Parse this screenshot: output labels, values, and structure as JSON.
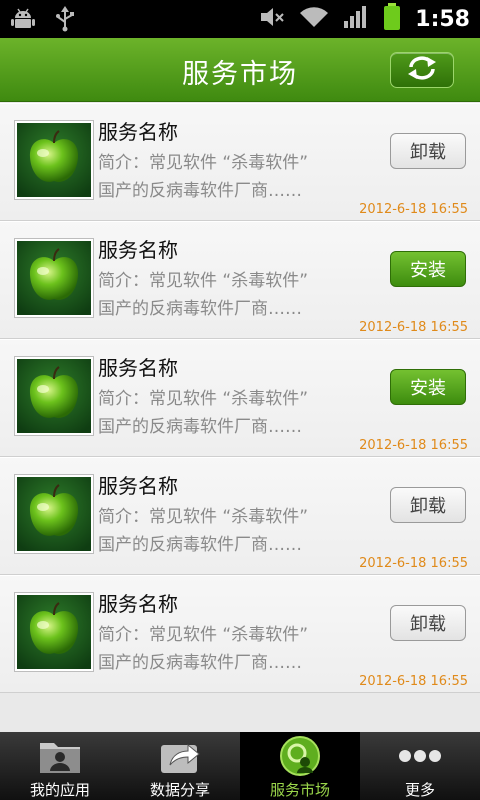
{
  "status_bar": {
    "time": "1:58",
    "icons": [
      "android-icon",
      "usb-icon",
      "mute-icon",
      "wifi-icon",
      "signal-icon",
      "battery-icon"
    ]
  },
  "header": {
    "title": "服务市场",
    "refresh_icon": "refresh-icon"
  },
  "colors": {
    "accent_green": "#4f9a1a",
    "date_orange": "#e08a1a",
    "active_tab_label": "#9ad64b"
  },
  "services": [
    {
      "name": "服务名称",
      "desc_line1": "简介：常见软件 “杀毒软件”",
      "desc_line2": "国产的反病毒软件厂商……",
      "date": "2012-6-18  16:55",
      "action": "卸载",
      "action_type": "uninstall"
    },
    {
      "name": "服务名称",
      "desc_line1": "简介：常见软件 “杀毒软件”",
      "desc_line2": "国产的反病毒软件厂商……",
      "date": "2012-6-18  16:55",
      "action": "安装",
      "action_type": "install"
    },
    {
      "name": "服务名称",
      "desc_line1": "简介：常见软件 “杀毒软件”",
      "desc_line2": "国产的反病毒软件厂商……",
      "date": "2012-6-18  16:55",
      "action": "安装",
      "action_type": "install"
    },
    {
      "name": "服务名称",
      "desc_line1": "简介：常见软件 “杀毒软件”",
      "desc_line2": "国产的反病毒软件厂商……",
      "date": "2012-6-18  16:55",
      "action": "卸载",
      "action_type": "uninstall"
    },
    {
      "name": "服务名称",
      "desc_line1": "简介：常见软件 “杀毒软件”",
      "desc_line2": "国产的反病毒软件厂商……",
      "date": "2012-6-18  16:55",
      "action": "卸载",
      "action_type": "uninstall"
    }
  ],
  "tabs": [
    {
      "label": "我的应用",
      "icon": "my-apps-icon",
      "active": false
    },
    {
      "label": "数据分享",
      "icon": "share-icon",
      "active": false
    },
    {
      "label": "服务市场",
      "icon": "service-market-icon",
      "active": true
    },
    {
      "label": "更多",
      "icon": "more-icon",
      "active": false
    }
  ]
}
